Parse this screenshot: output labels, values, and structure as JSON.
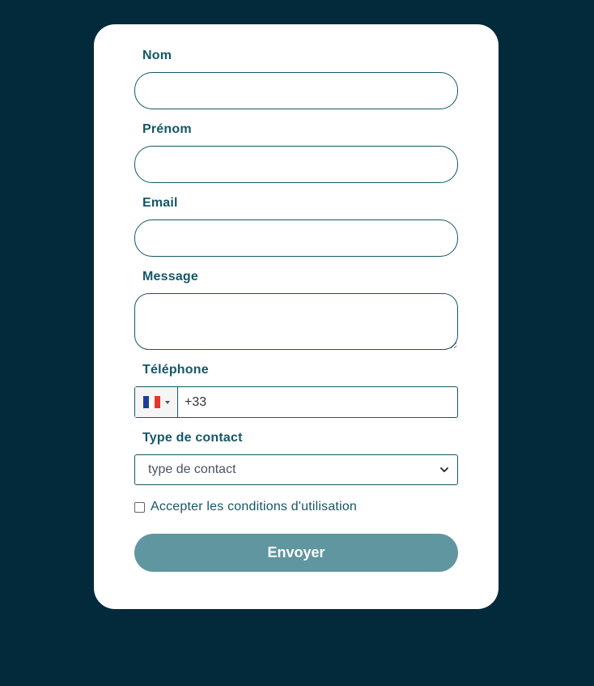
{
  "form": {
    "fields": {
      "nom": {
        "label": "Nom",
        "value": ""
      },
      "prenom": {
        "label": "Prénom",
        "value": ""
      },
      "email": {
        "label": "Email",
        "value": ""
      },
      "message": {
        "label": "Message",
        "value": ""
      },
      "telephone": {
        "label": "Téléphone",
        "value": "+33",
        "country_flag": "france-flag-icon"
      },
      "type_contact": {
        "label": "Type de contact",
        "selected": "type de contact"
      }
    },
    "terms_label": "Accepter les conditions d'utilisation",
    "terms_checked": false,
    "submit_label": "Envoyer"
  },
  "colors": {
    "page_background": "#022a3a",
    "card_background": "#ffffff",
    "label_text": "#155766",
    "input_border": "#155766",
    "button_background": "#5f969f",
    "button_text": "#ffffff",
    "flag_blue": "#1f3d9a",
    "flag_white": "#ffffff",
    "flag_red": "#e3342f"
  }
}
